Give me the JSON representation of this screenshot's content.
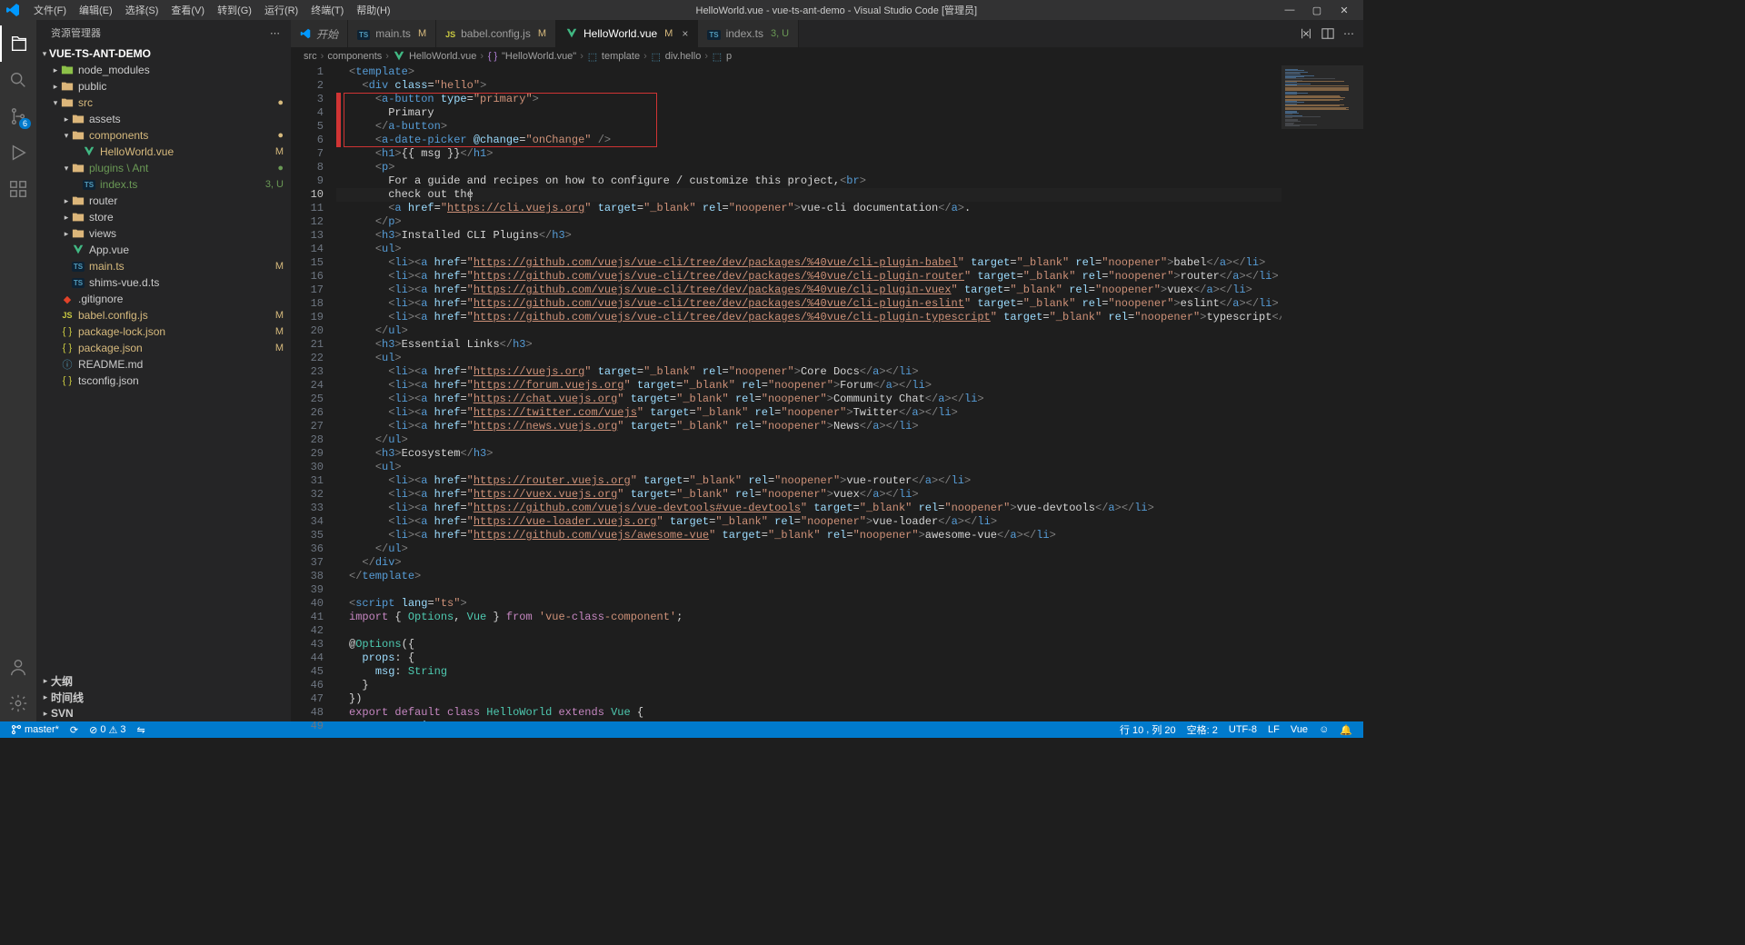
{
  "title": "HelloWorld.vue - vue-ts-ant-demo - Visual Studio Code [管理员]",
  "menu": [
    "文件(F)",
    "编辑(E)",
    "选择(S)",
    "查看(V)",
    "转到(G)",
    "运行(R)",
    "终端(T)",
    "帮助(H)"
  ],
  "sidebar": {
    "title": "资源管理器",
    "project": "VUE-TS-ANT-DEMO",
    "tree": [
      {
        "d": 1,
        "t": "folder-c",
        "label": "node_modules",
        "cls": "",
        "ic": "nm"
      },
      {
        "d": 1,
        "t": "folder-c",
        "label": "public",
        "cls": "",
        "ic": "folder"
      },
      {
        "d": 1,
        "t": "folder-o",
        "label": "src",
        "cls": "mod",
        "ic": "folder-open",
        "dot": true
      },
      {
        "d": 2,
        "t": "folder-c",
        "label": "assets",
        "cls": "",
        "ic": "folder"
      },
      {
        "d": 2,
        "t": "folder-o",
        "label": "components",
        "cls": "mod",
        "ic": "folder-open",
        "dot": true
      },
      {
        "d": 3,
        "t": "file",
        "label": "HelloWorld.vue",
        "cls": "mod",
        "ic": "vue",
        "suffix": "M"
      },
      {
        "d": 2,
        "t": "folder-o",
        "label": "plugins \\ Ant",
        "cls": "untracked",
        "ic": "folder-open",
        "dot": true
      },
      {
        "d": 3,
        "t": "file",
        "label": "index.ts",
        "cls": "untracked",
        "ic": "ts",
        "suffix": "3, U"
      },
      {
        "d": 2,
        "t": "folder-c",
        "label": "router",
        "cls": "",
        "ic": "folder"
      },
      {
        "d": 2,
        "t": "folder-c",
        "label": "store",
        "cls": "",
        "ic": "folder"
      },
      {
        "d": 2,
        "t": "folder-c",
        "label": "views",
        "cls": "",
        "ic": "folder"
      },
      {
        "d": 2,
        "t": "file",
        "label": "App.vue",
        "cls": "",
        "ic": "vue"
      },
      {
        "d": 2,
        "t": "file",
        "label": "main.ts",
        "cls": "mod",
        "ic": "ts",
        "suffix": "M"
      },
      {
        "d": 2,
        "t": "file",
        "label": "shims-vue.d.ts",
        "cls": "",
        "ic": "ts"
      },
      {
        "d": 1,
        "t": "file",
        "label": ".gitignore",
        "cls": "",
        "ic": "git"
      },
      {
        "d": 1,
        "t": "file",
        "label": "babel.config.js",
        "cls": "mod",
        "ic": "js",
        "suffix": "M"
      },
      {
        "d": 1,
        "t": "file",
        "label": "package-lock.json",
        "cls": "mod",
        "ic": "json",
        "suffix": "M"
      },
      {
        "d": 1,
        "t": "file",
        "label": "package.json",
        "cls": "mod",
        "ic": "json",
        "suffix": "M"
      },
      {
        "d": 1,
        "t": "file",
        "label": "README.md",
        "cls": "",
        "ic": "md"
      },
      {
        "d": 1,
        "t": "file",
        "label": "tsconfig.json",
        "cls": "",
        "ic": "json"
      }
    ],
    "collapsed": [
      "大纲",
      "时间线",
      "SVN"
    ]
  },
  "tabs": [
    {
      "label": "开始",
      "ic": "vs",
      "suffix": "",
      "active": false,
      "italic": true
    },
    {
      "label": "main.ts",
      "ic": "ts",
      "suffix": "M",
      "active": false,
      "italic": false,
      "suffixColor": "#d7ba7d"
    },
    {
      "label": "babel.config.js",
      "ic": "js",
      "suffix": "M",
      "active": false,
      "italic": false,
      "suffixColor": "#d7ba7d"
    },
    {
      "label": "HelloWorld.vue",
      "ic": "vue",
      "suffix": "M",
      "active": true,
      "italic": false,
      "close": true,
      "suffixColor": "#d7ba7d"
    },
    {
      "label": "index.ts",
      "ic": "ts",
      "suffix": "3, U",
      "active": false,
      "italic": false,
      "suffixColor": "#6a9955"
    }
  ],
  "breadcrumbs": [
    "src",
    "components",
    "HelloWorld.vue",
    "\"HelloWorld.vue\"",
    "template",
    "div.hello",
    "p"
  ],
  "activity_badge": "6",
  "code": {
    "lines": 48,
    "currentLine": 10,
    "highlightBox": {
      "from": 3,
      "to": 6
    },
    "content": [
      "<template>",
      "  <div class=\"hello\">",
      "    <a-button type=\"primary\">",
      "      Primary",
      "    </a-button>",
      "    <a-date-picker @change=\"onChange\" />",
      "    <h1>{{ msg }}</h1>",
      "    <p>",
      "      For a guide and recipes on how to configure / customize this project,<br>",
      "      check out the",
      "      <a href=\"https://cli.vuejs.org\" target=\"_blank\" rel=\"noopener\">vue-cli documentation</a>.",
      "    </p>",
      "    <h3>Installed CLI Plugins</h3>",
      "    <ul>",
      "      <li><a href=\"https://github.com/vuejs/vue-cli/tree/dev/packages/%40vue/cli-plugin-babel\" target=\"_blank\" rel=\"noopener\">babel</a></li>",
      "      <li><a href=\"https://github.com/vuejs/vue-cli/tree/dev/packages/%40vue/cli-plugin-router\" target=\"_blank\" rel=\"noopener\">router</a></li>",
      "      <li><a href=\"https://github.com/vuejs/vue-cli/tree/dev/packages/%40vue/cli-plugin-vuex\" target=\"_blank\" rel=\"noopener\">vuex</a></li>",
      "      <li><a href=\"https://github.com/vuejs/vue-cli/tree/dev/packages/%40vue/cli-plugin-eslint\" target=\"_blank\" rel=\"noopener\">eslint</a></li>",
      "      <li><a href=\"https://github.com/vuejs/vue-cli/tree/dev/packages/%40vue/cli-plugin-typescript\" target=\"_blank\" rel=\"noopener\">typescript</a></li>",
      "    </ul>",
      "    <h3>Essential Links</h3>",
      "    <ul>",
      "      <li><a href=\"https://vuejs.org\" target=\"_blank\" rel=\"noopener\">Core Docs</a></li>",
      "      <li><a href=\"https://forum.vuejs.org\" target=\"_blank\" rel=\"noopener\">Forum</a></li>",
      "      <li><a href=\"https://chat.vuejs.org\" target=\"_blank\" rel=\"noopener\">Community Chat</a></li>",
      "      <li><a href=\"https://twitter.com/vuejs\" target=\"_blank\" rel=\"noopener\">Twitter</a></li>",
      "      <li><a href=\"https://news.vuejs.org\" target=\"_blank\" rel=\"noopener\">News</a></li>",
      "    </ul>",
      "    <h3>Ecosystem</h3>",
      "    <ul>",
      "      <li><a href=\"https://router.vuejs.org\" target=\"_blank\" rel=\"noopener\">vue-router</a></li>",
      "      <li><a href=\"https://vuex.vuejs.org\" target=\"_blank\" rel=\"noopener\">vuex</a></li>",
      "      <li><a href=\"https://github.com/vuejs/vue-devtools#vue-devtools\" target=\"_blank\" rel=\"noopener\">vue-devtools</a></li>",
      "      <li><a href=\"https://vue-loader.vuejs.org\" target=\"_blank\" rel=\"noopener\">vue-loader</a></li>",
      "      <li><a href=\"https://github.com/vuejs/awesome-vue\" target=\"_blank\" rel=\"noopener\">awesome-vue</a></li>",
      "    </ul>",
      "  </div>",
      "</template>",
      "",
      "<script lang=\"ts\">",
      "import { Options, Vue } from 'vue-class-component';",
      "",
      "@Options({",
      "  props: {",
      "    msg: String",
      "  }",
      "})",
      "export default class HelloWorld extends Vue {",
      "  msg!: string"
    ]
  },
  "status": {
    "branch": "master*",
    "sync": "⟳",
    "errors": "0",
    "warnings": "3",
    "port": "⇋",
    "line": "行 10",
    "col": "列 20",
    "spaces": "空格: 2",
    "encoding": "UTF-8",
    "eol": "LF",
    "lang": "Vue",
    "bell": "🔔"
  }
}
